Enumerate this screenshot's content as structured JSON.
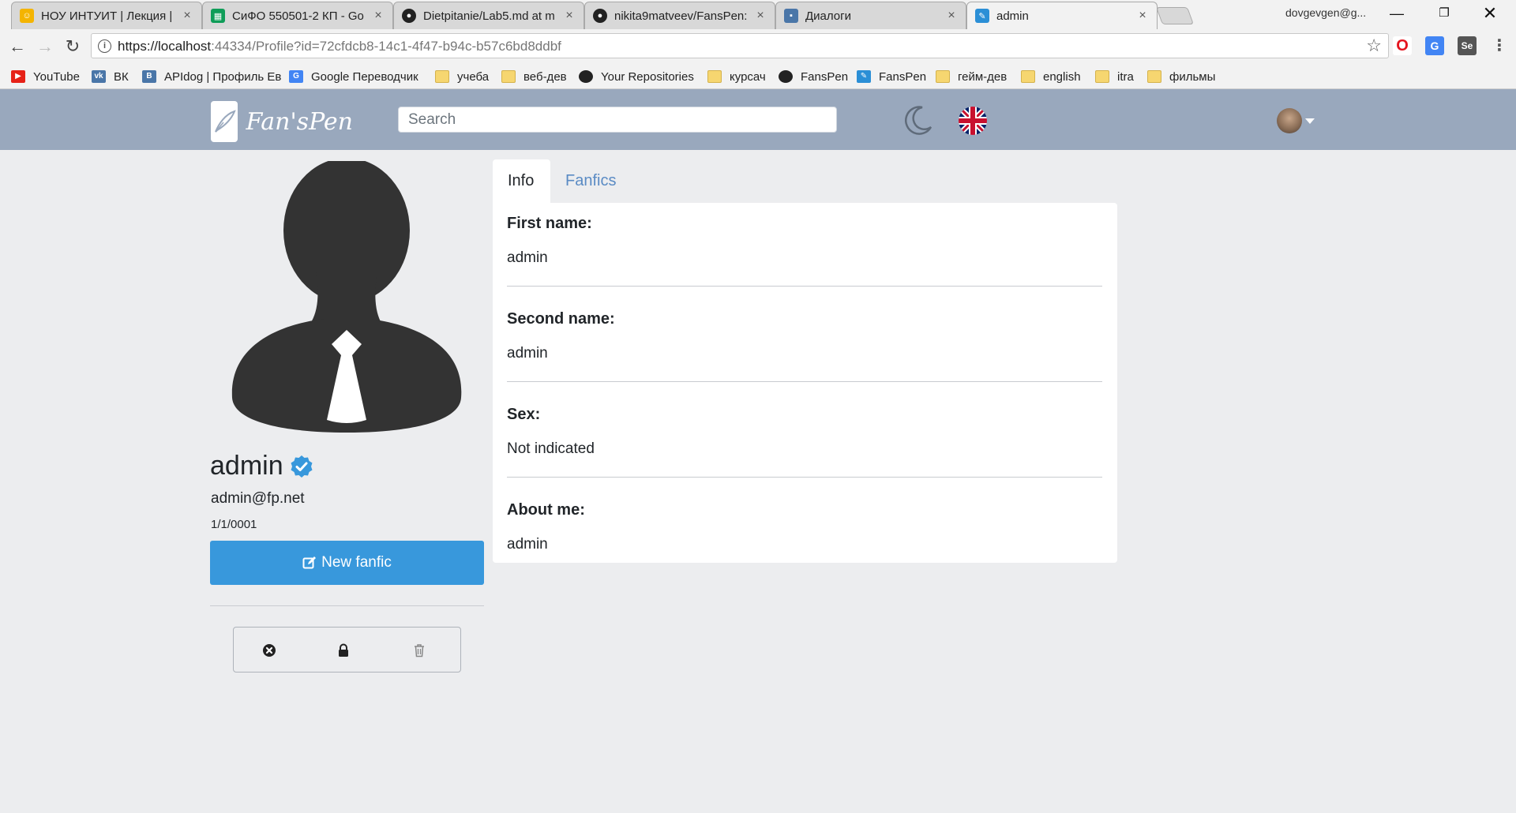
{
  "browser": {
    "tabs": [
      {
        "title": "НОУ ИНТУИТ | Лекция |",
        "icon_color": "#f4b400"
      },
      {
        "title": "СиФО 550501-2 КП - Go",
        "icon_color": "#0f9d58"
      },
      {
        "title": "Dietpitanie/Lab5.md at m",
        "icon_color": "#222222"
      },
      {
        "title": "nikita9matveev/FansPen:",
        "icon_color": "#222222"
      },
      {
        "title": "Диалоги",
        "icon_color": "#4a76a8"
      },
      {
        "title": "admin",
        "icon_color": "#2b8fd6"
      }
    ],
    "tab_close": "×",
    "profile_name": "dovgevgen@g...",
    "url_host": "https://localhost",
    "url_rest": ":44334/Profile?id=72cfdcb8-14c1-4f47-b94c-b57c6bd8ddbf",
    "bookmarks": [
      {
        "label": "YouTube",
        "icon": "youtube-icon",
        "color": "#e62117"
      },
      {
        "label": "ВК",
        "icon": "vk-icon",
        "color": "#4a76a8"
      },
      {
        "label": "APIdog | Профиль Ев",
        "icon": "apidog-icon",
        "color": "#4a76a8"
      },
      {
        "label": "Google Переводчик",
        "icon": "google-translate-icon",
        "color": "#4285f4"
      },
      {
        "label": "учеба",
        "icon": "folder-icon",
        "color": "#f6d670"
      },
      {
        "label": "веб-дев",
        "icon": "folder-icon",
        "color": "#f6d670"
      },
      {
        "label": "Your Repositories",
        "icon": "github-icon",
        "color": "#222222"
      },
      {
        "label": "курсач",
        "icon": "folder-icon",
        "color": "#f6d670"
      },
      {
        "label": "FansPen",
        "icon": "github-icon",
        "color": "#222222"
      },
      {
        "label": "FansPen",
        "icon": "fanspen-icon",
        "color": "#2b8fd6"
      },
      {
        "label": "гейм-дев",
        "icon": "folder-icon",
        "color": "#f6d670"
      },
      {
        "label": "english",
        "icon": "folder-icon",
        "color": "#f6d670"
      },
      {
        "label": "itra",
        "icon": "folder-icon",
        "color": "#f6d670"
      },
      {
        "label": "фильмы",
        "icon": "folder-icon",
        "color": "#f6d670"
      }
    ]
  },
  "header": {
    "logo_text": "Fan'sPen",
    "search_placeholder": "Search",
    "header_color": "#99a8bd"
  },
  "profile": {
    "username": "admin",
    "email": "admin@fp.net",
    "date": "1/1/0001",
    "new_fanfic_label": "New fanfic",
    "button_color": "#3898dc"
  },
  "tabs": {
    "info": "Info",
    "fanfics": "Fanfics"
  },
  "info": [
    {
      "label": "First name:",
      "value": "admin"
    },
    {
      "label": "Second name:",
      "value": "admin"
    },
    {
      "label": "Sex:",
      "value": "Not indicated"
    },
    {
      "label": "About me:",
      "value": "admin"
    }
  ]
}
